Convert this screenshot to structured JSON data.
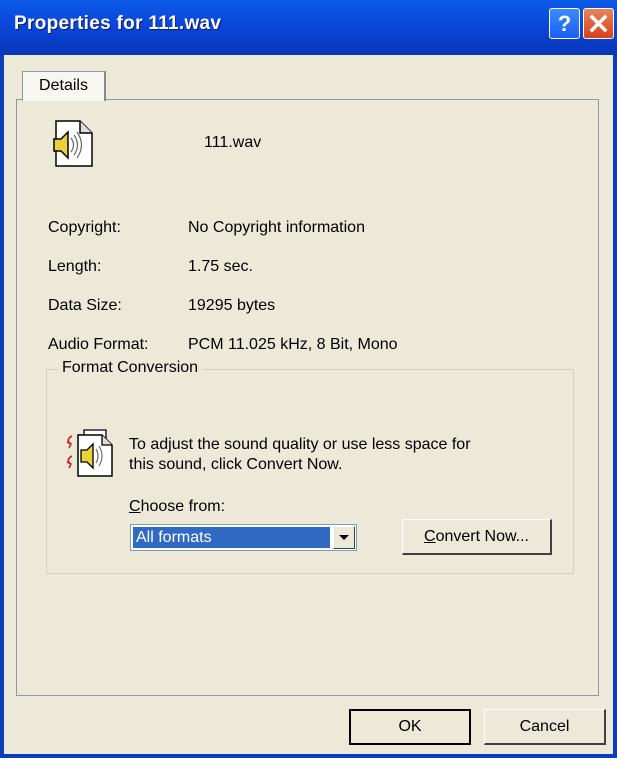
{
  "window": {
    "title": "Properties for 111.wav"
  },
  "tabs": [
    {
      "label": "Details"
    }
  ],
  "file": {
    "name": "111.wav"
  },
  "details": [
    {
      "label": "Copyright:",
      "value": "No Copyright information"
    },
    {
      "label": "Length:",
      "value": "1.75 sec."
    },
    {
      "label": "Data Size:",
      "value": "19295 bytes"
    },
    {
      "label": "Audio Format:",
      "value": "PCM 11.025 kHz, 8 Bit, Mono"
    }
  ],
  "format_conversion": {
    "group_label": "Format Conversion",
    "description_line1": "To adjust the sound quality or use less space for",
    "description_line2": "this sound, click Convert Now.",
    "choose_from_label_accel": "C",
    "choose_from_label_rest": "hoose from:",
    "choose_from_value": "All formats",
    "convert_button_accel": "C",
    "convert_button_rest": "onvert Now..."
  },
  "buttons": {
    "ok": "OK",
    "cancel": "Cancel"
  },
  "titlebar_buttons": {
    "help": "?"
  },
  "icons": [
    "wav-file-icon",
    "convert-sound-icon",
    "help-icon",
    "close-icon",
    "chevron-down-icon"
  ],
  "colors": {
    "titlebar": "#0a45d8",
    "dialog_bg": "#ece9d8",
    "selection": "#316ac5",
    "close_button": "#d6411a"
  }
}
